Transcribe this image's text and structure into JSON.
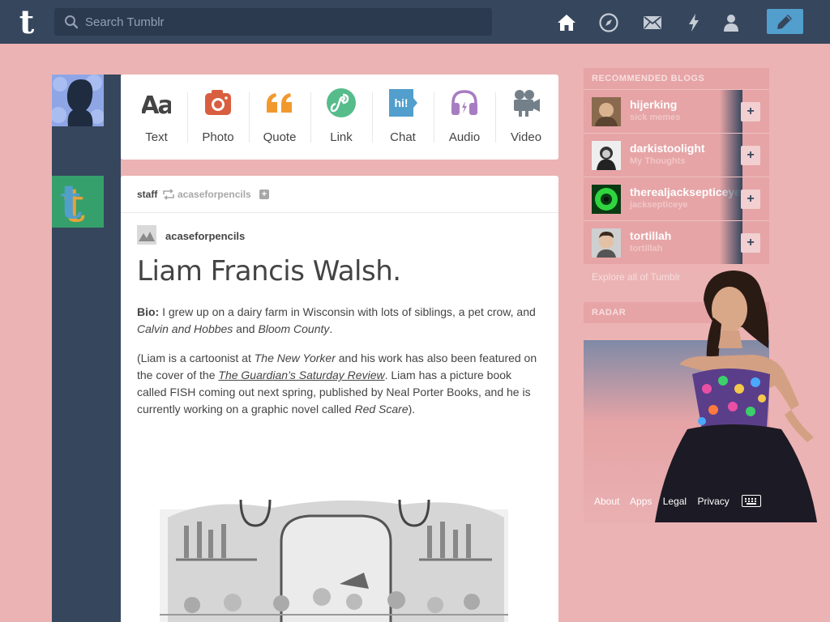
{
  "header": {
    "search_placeholder": "Search Tumblr",
    "logo_letter": "t",
    "icons": [
      "home-icon",
      "explore-icon",
      "inbox-icon",
      "activity-icon",
      "account-icon"
    ],
    "compose_icon": "pencil-icon"
  },
  "post_types": [
    {
      "label": "Text",
      "glyph": "Aa",
      "color": "#444444"
    },
    {
      "label": "Photo",
      "color": "#d95e40"
    },
    {
      "label": "Quote",
      "color": "#f2992e"
    },
    {
      "label": "Link",
      "color": "#56bc8a"
    },
    {
      "label": "Chat",
      "glyph": "hi!",
      "color": "#529ecc"
    },
    {
      "label": "Audio",
      "color": "#a77dc2"
    },
    {
      "label": "Video",
      "color": "#748089"
    }
  ],
  "post": {
    "user": "staff",
    "reblogged_from": "acaseforpencils",
    "source_blog": "acaseforpencils",
    "title": "Liam Francis Walsh.",
    "bio_label": "Bio:",
    "bio_text_1": " I grew up on a dairy farm in Wisconsin with lots of siblings, a pet crow, and ",
    "bio_em_1": "Calvin and Hobbes",
    "bio_and": " and ",
    "bio_em_2": "Bloom County",
    "bio_end": ".",
    "p2_a": "(Liam is a cartoonist at ",
    "p2_em_1": "The New Yorker",
    "p2_b": " and his work has also been featured on the cover of the ",
    "p2_link": "The Guardian’s Saturday Review",
    "p2_c": ". Liam has a picture book called FISH coming out next spring, published by Neal Porter Books, and he is currently working on a graphic novel called ",
    "p2_em_2": "Red Scare",
    "p2_d": ")."
  },
  "sidebar": {
    "recommended_title": "RECOMMENDED BLOGS",
    "blogs": [
      {
        "name": "hijerking",
        "subtitle": "sick memes"
      },
      {
        "name": "darkistoolight",
        "subtitle": "My Thoughts"
      },
      {
        "name": "therealjacksepticeye",
        "subtitle": "jacksepticeye"
      },
      {
        "name": "tortillah",
        "subtitle": "tortillah"
      }
    ],
    "follow_label": "+",
    "explore_link": "Explore all of Tumblr",
    "radar_title": "RADAR",
    "footer_links": [
      "About",
      "Apps",
      "Legal",
      "Privacy"
    ]
  },
  "colors": {
    "background": "#ecb3b4",
    "navy": "#36465d",
    "compose_blue": "#529ecc"
  }
}
